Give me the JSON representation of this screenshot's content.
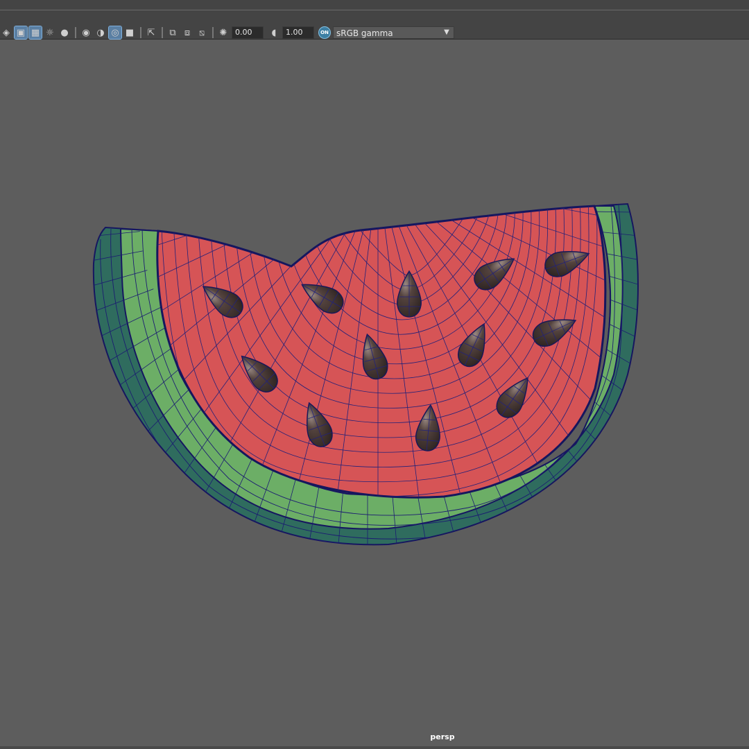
{
  "toolbar": {
    "icons": [
      "wireframe-shade-icon",
      "bounding-box-icon",
      "textured-icon",
      "lighting-icon",
      "shadows-icon",
      "ambient-occlusion-icon",
      "screen-space-ao-icon",
      "motion-blur-icon",
      "multisample-aa-icon",
      "isolate-select-icon",
      "xray-icon",
      "xray-joints-icon",
      "xray-components-icon",
      "exposure-icon",
      "gamma-icon"
    ],
    "exposure_value": "0.00",
    "gamma_value": "1.00",
    "color_management_label": "ON",
    "color_space": "sRGB gamma"
  },
  "viewport": {
    "camera": "persp",
    "background_color": "#5d5d5d",
    "flesh_color": "#d65456",
    "rind_inner_color": "#6cae66",
    "rind_outer_color": "#2e6b5d",
    "seed_color": "#463733",
    "wire_color": "#1a1a6e"
  }
}
